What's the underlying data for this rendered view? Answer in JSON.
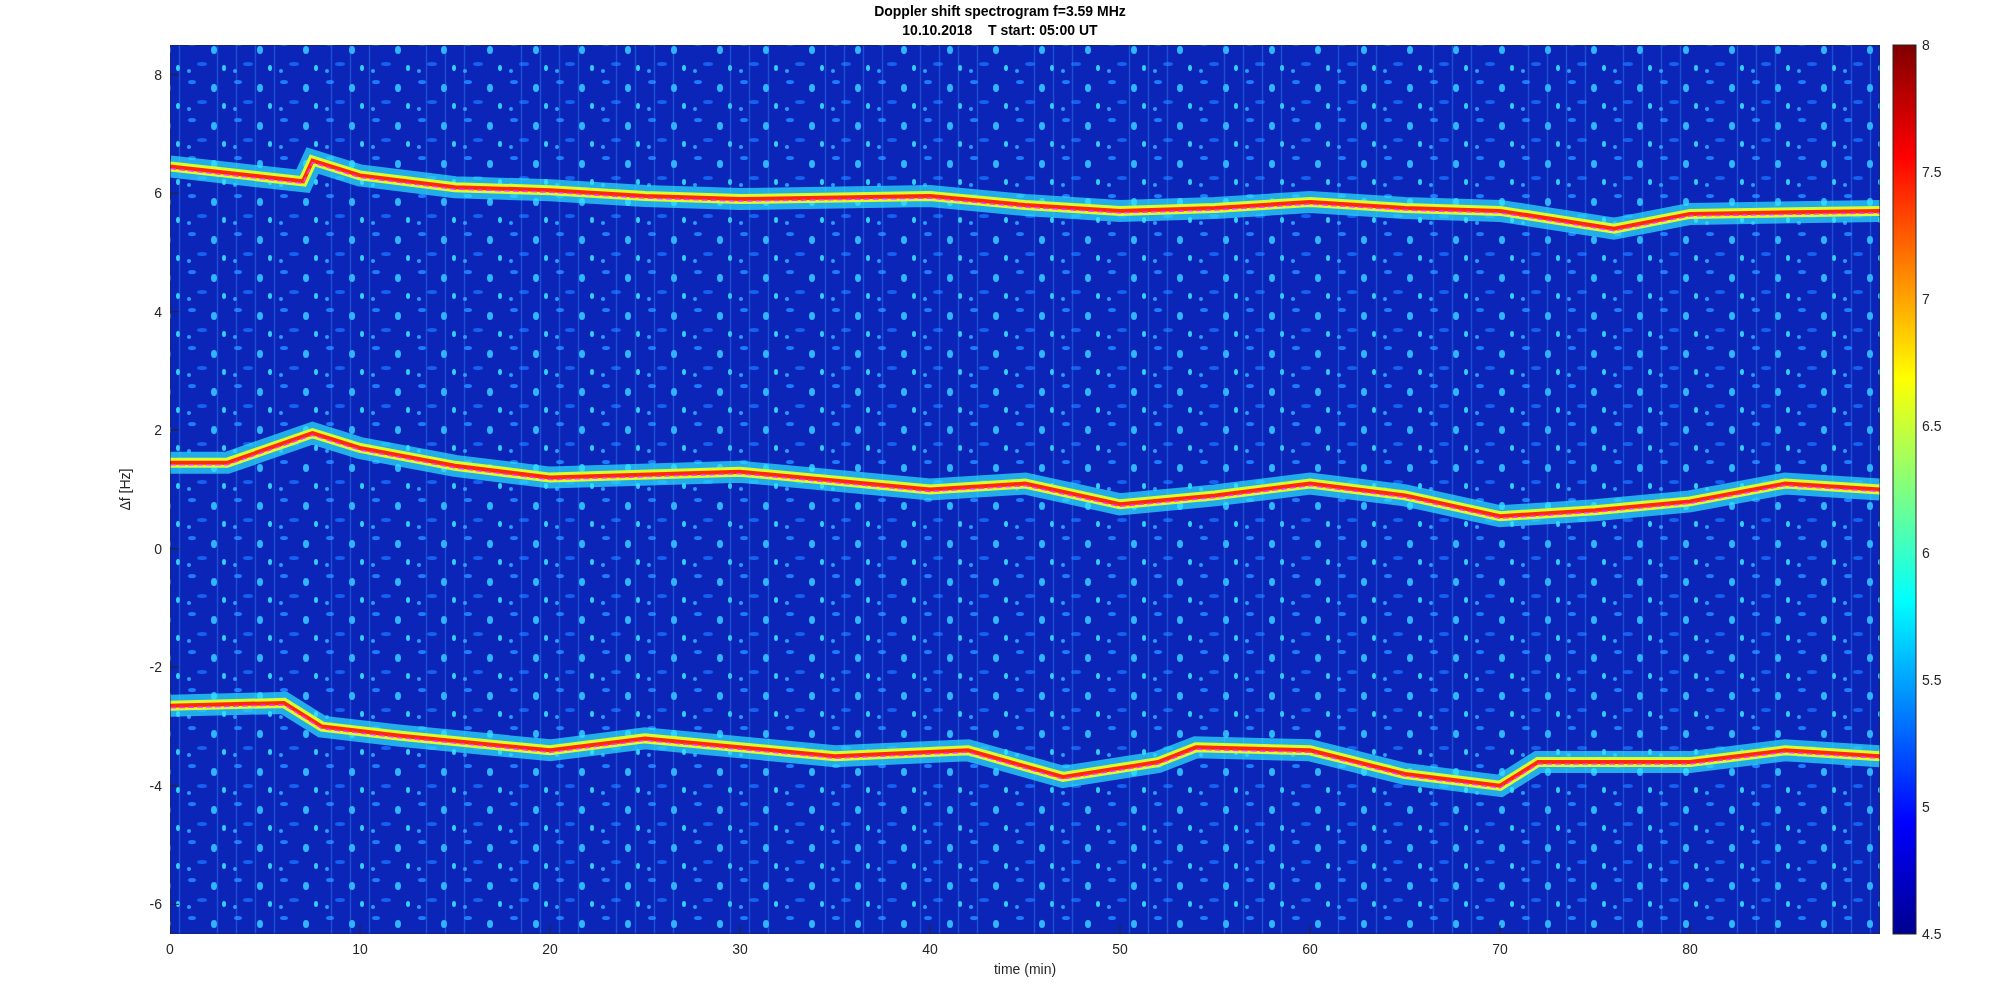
{
  "figure": {
    "title": "Doppler shift spectrogram f=3.59 MHz",
    "subtitle": "10.10.2018    T start: 05:00 UT"
  },
  "x_axis": {
    "label": "time (min)",
    "ticks": [
      "0",
      "10",
      "20",
      "30",
      "40",
      "50",
      "60",
      "70",
      "80"
    ]
  },
  "y_axis": {
    "label": "Δf [Hz]",
    "ticks": [
      "8",
      "6",
      "4",
      "2",
      "0",
      "-2",
      "-4",
      "-6"
    ]
  },
  "colorbar": {
    "ticks": [
      "8",
      "7.5",
      "7",
      "6.5",
      "6",
      "5.5",
      "5",
      "4.5"
    ]
  }
}
